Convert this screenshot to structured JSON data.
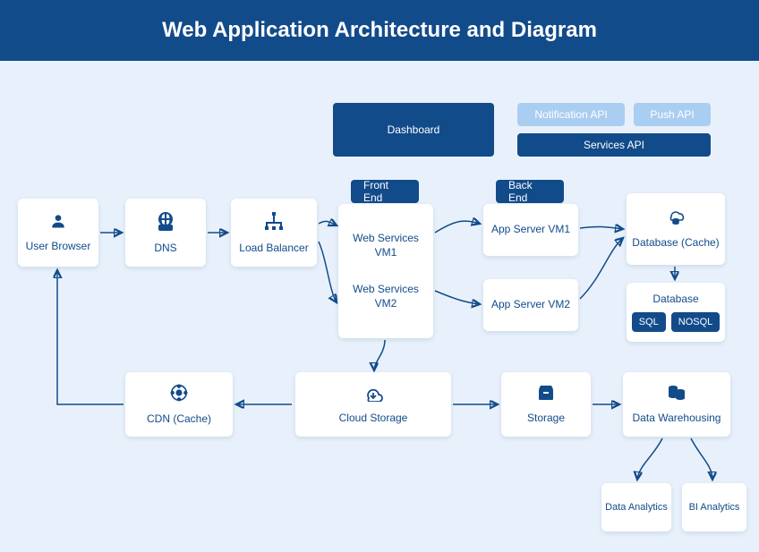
{
  "title": "Web Application Architecture and Diagram",
  "topRow": {
    "dashboard": "Dashboard",
    "notification": "Notification API",
    "push": "Push API",
    "services": "Services API"
  },
  "labels": {
    "frontEnd": "Front End",
    "backEnd": "Back End"
  },
  "nodes": {
    "userBrowser": "User Browser",
    "dns": "DNS",
    "loadBalancer": "Load Balancer",
    "webServicesVM1": "Web Services VM1",
    "webServicesVM2": "Web Services VM2",
    "appServerVM1": "App Server VM1",
    "appServerVM2": "App Server VM2",
    "databaseCache": "Database (Cache)",
    "database": "Database",
    "sql": "SQL",
    "nosql": "NOSQL",
    "cdn": "CDN (Cache)",
    "cloudStorage": "Cloud Storage",
    "storage": "Storage",
    "dataWarehousing": "Data Warehousing",
    "dataAnalytics": "Data Analytics",
    "biAnalytics": "BI Analytics"
  }
}
